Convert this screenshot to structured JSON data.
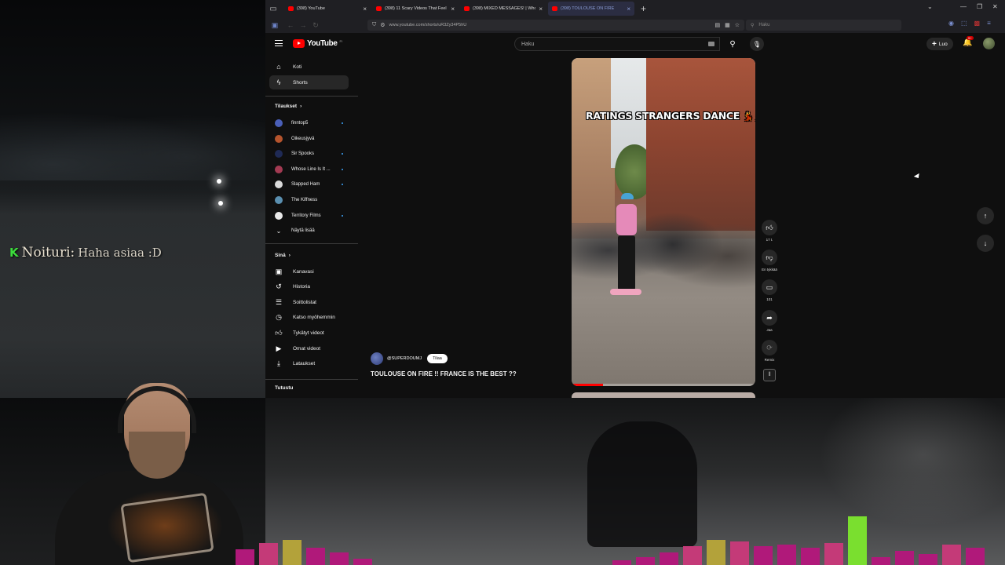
{
  "overlay": {
    "chat_badge": "K",
    "chat_name": "Noituri:",
    "chat_message": "Haha asiaa :D"
  },
  "browser": {
    "tabs": [
      {
        "label": "(398) YouTube",
        "active": false
      },
      {
        "label": "(398) 11 Scary Videos That Feel",
        "active": false
      },
      {
        "label": "(398) MIXED MESSAGES! | Who",
        "active": false
      },
      {
        "label": "(398) TOULOUSE ON FIRE",
        "active": true
      }
    ],
    "url": "www.youtube.com/shorts/uR3Zy34P5hU",
    "search_placeholder": "Haku"
  },
  "youtube": {
    "logo_text": "YouTube",
    "logo_country": "FI",
    "search_placeholder": "Haku",
    "create_label": "Luo",
    "notif_badge": "9+",
    "sidebar": {
      "main": [
        {
          "label": "Koti",
          "icon": "home-icon",
          "active": false
        },
        {
          "label": "Shorts",
          "icon": "shorts-icon",
          "active": true
        }
      ],
      "subscriptions_title": "Tilaukset",
      "subscriptions": [
        {
          "label": "finntop5",
          "color": "#4a5fb8",
          "new": true
        },
        {
          "label": "Oikeusjyvä",
          "color": "#b5542d",
          "new": false
        },
        {
          "label": "Sir Spooks",
          "color": "#1f2a55",
          "new": true
        },
        {
          "label": "Whose Line Is It ...",
          "color": "#a33a52",
          "new": true
        },
        {
          "label": "Slapped Ham",
          "color": "#d9d9d9",
          "new": true
        },
        {
          "label": "The Kiffness",
          "color": "#5a8fb0",
          "new": false
        },
        {
          "label": "Territory Films",
          "color": "#e8e8e8",
          "new": true
        }
      ],
      "show_more": "Näytä lisää",
      "you_title": "Sinä",
      "you_items": [
        {
          "label": "Kanavasi",
          "icon": "channel-icon"
        },
        {
          "label": "Historia",
          "icon": "history-icon"
        },
        {
          "label": "Soittolistat",
          "icon": "playlists-icon"
        },
        {
          "label": "Katso myöhemmin",
          "icon": "watch-later-icon"
        },
        {
          "label": "Tykätyt videot",
          "icon": "liked-icon"
        },
        {
          "label": "Omat videot",
          "icon": "your-videos-icon"
        },
        {
          "label": "Lataukset",
          "icon": "downloads-icon"
        }
      ],
      "explore_title": "Tutustu"
    },
    "short": {
      "caption": "RATINGS STRANGERS DANCE",
      "caption_emoji": "💃💃",
      "channel_handle": "@SUPERDOUMJ",
      "subscribe_label": "Tilaa",
      "title": "TOULOUSE ON FIRE !! FRANCE IS THE BEST ??",
      "progress": 0.17,
      "actions": {
        "like_count": "17 t.",
        "dislike_label": "En tykkää",
        "comment_count": "101",
        "share_label": "Jaa",
        "remix_label": "Remix"
      }
    }
  },
  "colors": {
    "yt_bg": "#0f0f0f",
    "yt_red": "#ff0000",
    "active_tab": "#2b2d42"
  }
}
